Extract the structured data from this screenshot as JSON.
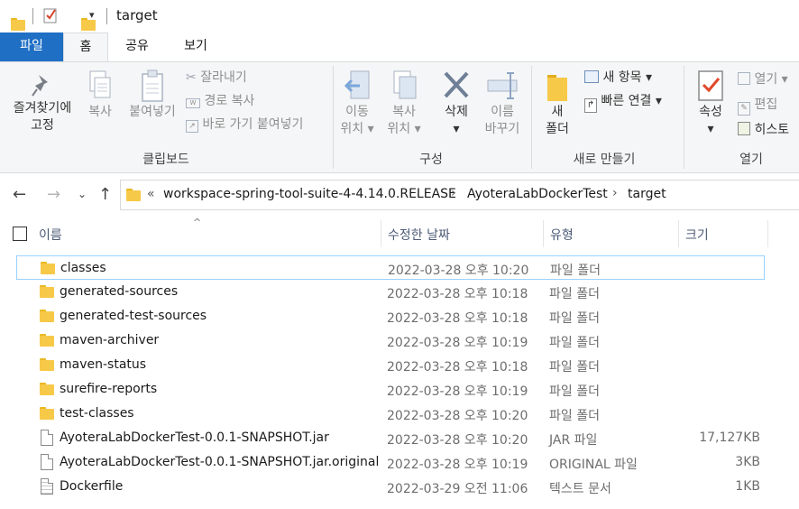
{
  "window": {
    "title": "target"
  },
  "tabs": {
    "file": "파일",
    "home": "홈",
    "share": "공유",
    "view": "보기"
  },
  "ribbon": {
    "clipboard": {
      "pin_line1": "즐겨찾기에",
      "pin_line2": "고정",
      "copy": "복사",
      "paste": "붙여넣기",
      "cut": "잘라내기",
      "copy_path": "경로 복사",
      "paste_shortcut": "바로 가기 붙여넣기",
      "label": "클립보드"
    },
    "organize": {
      "move_line1": "이동",
      "move_line2": "위치",
      "copyto_line1": "복사",
      "copyto_line2": "위치",
      "delete": "삭제",
      "rename_line1": "이름",
      "rename_line2": "바꾸기",
      "label": "구성"
    },
    "new": {
      "new_folder_line1": "새",
      "new_folder_line2": "폴더",
      "new_item": "새 항목",
      "easy_access": "빠른 연결",
      "label": "새로 만들기"
    },
    "open": {
      "properties": "속성",
      "open": "열기",
      "edit": "편집",
      "history": "히스토",
      "label": "열기"
    }
  },
  "address": {
    "overflow": "«",
    "crumbs": [
      "workspace-spring-tool-suite-4-4.14.0.RELEASE",
      "AyoteraLabDockerTest",
      "target"
    ]
  },
  "columns": {
    "name": "이름",
    "date": "수정한 날짜",
    "type": "유형",
    "size": "크기"
  },
  "files": [
    {
      "name": "classes",
      "date": "2022-03-28 오후 10:20",
      "type": "파일 폴더",
      "size": "",
      "icon": "folder-icon"
    },
    {
      "name": "generated-sources",
      "date": "2022-03-28 오후 10:18",
      "type": "파일 폴더",
      "size": "",
      "icon": "folder-icon"
    },
    {
      "name": "generated-test-sources",
      "date": "2022-03-28 오후 10:18",
      "type": "파일 폴더",
      "size": "",
      "icon": "folder-icon"
    },
    {
      "name": "maven-archiver",
      "date": "2022-03-28 오후 10:19",
      "type": "파일 폴더",
      "size": "",
      "icon": "folder-icon"
    },
    {
      "name": "maven-status",
      "date": "2022-03-28 오후 10:18",
      "type": "파일 폴더",
      "size": "",
      "icon": "folder-icon"
    },
    {
      "name": "surefire-reports",
      "date": "2022-03-28 오후 10:19",
      "type": "파일 폴더",
      "size": "",
      "icon": "folder-icon"
    },
    {
      "name": "test-classes",
      "date": "2022-03-28 오후 10:20",
      "type": "파일 폴더",
      "size": "",
      "icon": "folder-icon"
    },
    {
      "name": "AyoteraLabDockerTest-0.0.1-SNAPSHOT.jar",
      "date": "2022-03-28 오후 10:20",
      "type": "JAR 파일",
      "size": "17,127KB",
      "icon": "file-icon"
    },
    {
      "name": "AyoteraLabDockerTest-0.0.1-SNAPSHOT.jar.original",
      "date": "2022-03-28 오후 10:19",
      "type": "ORIGINAL 파일",
      "size": "3KB",
      "icon": "file-icon"
    },
    {
      "name": "Dockerfile",
      "date": "2022-03-29 오전 11:06",
      "type": "텍스트 문서",
      "size": "1KB",
      "icon": "text-file-icon"
    }
  ],
  "colors": {
    "accent": "#1f6fc5",
    "folder": "#f7c948",
    "selection": "#99d1ff"
  }
}
